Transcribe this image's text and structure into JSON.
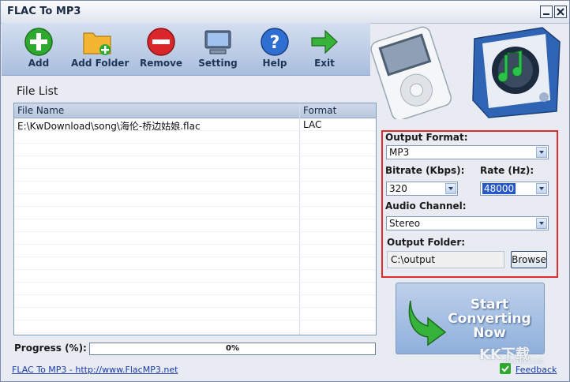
{
  "window": {
    "title": "FLAC To MP3",
    "min_icon": "minimize-icon",
    "close_icon": "close-icon"
  },
  "toolbar": {
    "add": "Add",
    "add_folder": "Add Folder",
    "remove": "Remove",
    "setting": "Setting",
    "help": "Help",
    "exit": "Exit"
  },
  "file_list": {
    "title": "File List",
    "columns": [
      "File Name",
      "Format"
    ],
    "rows": [
      {
        "name": "E:\\KwDownload\\song\\海伦-桥边姑娘.flac",
        "format": "LAC"
      }
    ]
  },
  "progress": {
    "label": "Progress (%):",
    "value_text": "0%",
    "value": 0
  },
  "settings": {
    "output_format_label": "Output Format:",
    "output_format": "MP3",
    "bitrate_label": "Bitrate (Kbps):",
    "bitrate": "320",
    "rate_label": "Rate (Hz):",
    "rate": "48000",
    "channel_label": "Audio Channel:",
    "channel": "Stereo",
    "folder_label": "Output Folder:",
    "folder": "C:\\output",
    "browse": "Browse"
  },
  "start_button": {
    "line1": "Start",
    "line2": "Converting",
    "line3": "Now"
  },
  "footer": {
    "link": "FLAC To MP3 - http://www.FlacMP3.net",
    "feedback": "Feedback"
  },
  "watermark": {
    "text": "KK下载",
    "sub": "www.kkx.net"
  },
  "colors": {
    "highlight_border": "#e12a2a",
    "toolbar": "#a9bedd",
    "selection": "#2758c9"
  }
}
